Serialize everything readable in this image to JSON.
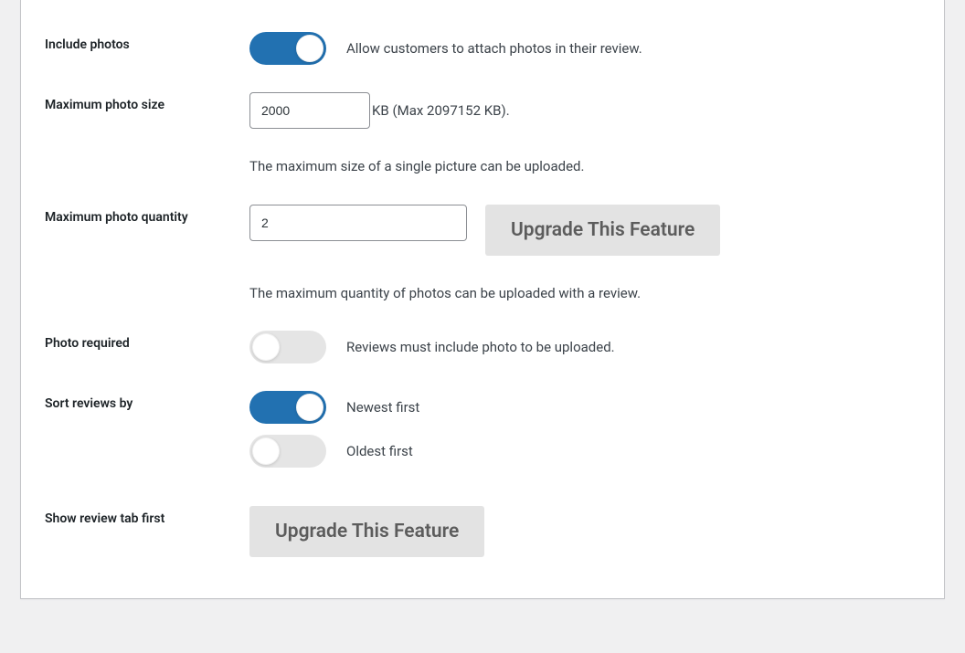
{
  "settings": {
    "include_photos": {
      "label": "Include photos",
      "description": "Allow customers to attach photos in their review."
    },
    "max_photo_size": {
      "label": "Maximum photo size",
      "value": "2000",
      "suffix": "KB (Max 2097152 KB).",
      "help": "The maximum size of a single picture can be uploaded."
    },
    "max_photo_qty": {
      "label": "Maximum photo quantity",
      "value": "2",
      "upgrade_label": "Upgrade This Feature",
      "help": "The maximum quantity of photos can be uploaded with a review."
    },
    "photo_required": {
      "label": "Photo required",
      "description": "Reviews must include photo to be uploaded."
    },
    "sort_reviews": {
      "label": "Sort reviews by",
      "option_newest": "Newest first",
      "option_oldest": "Oldest first"
    },
    "show_review_tab_first": {
      "label": "Show review tab first",
      "upgrade_label": "Upgrade This Feature"
    }
  }
}
